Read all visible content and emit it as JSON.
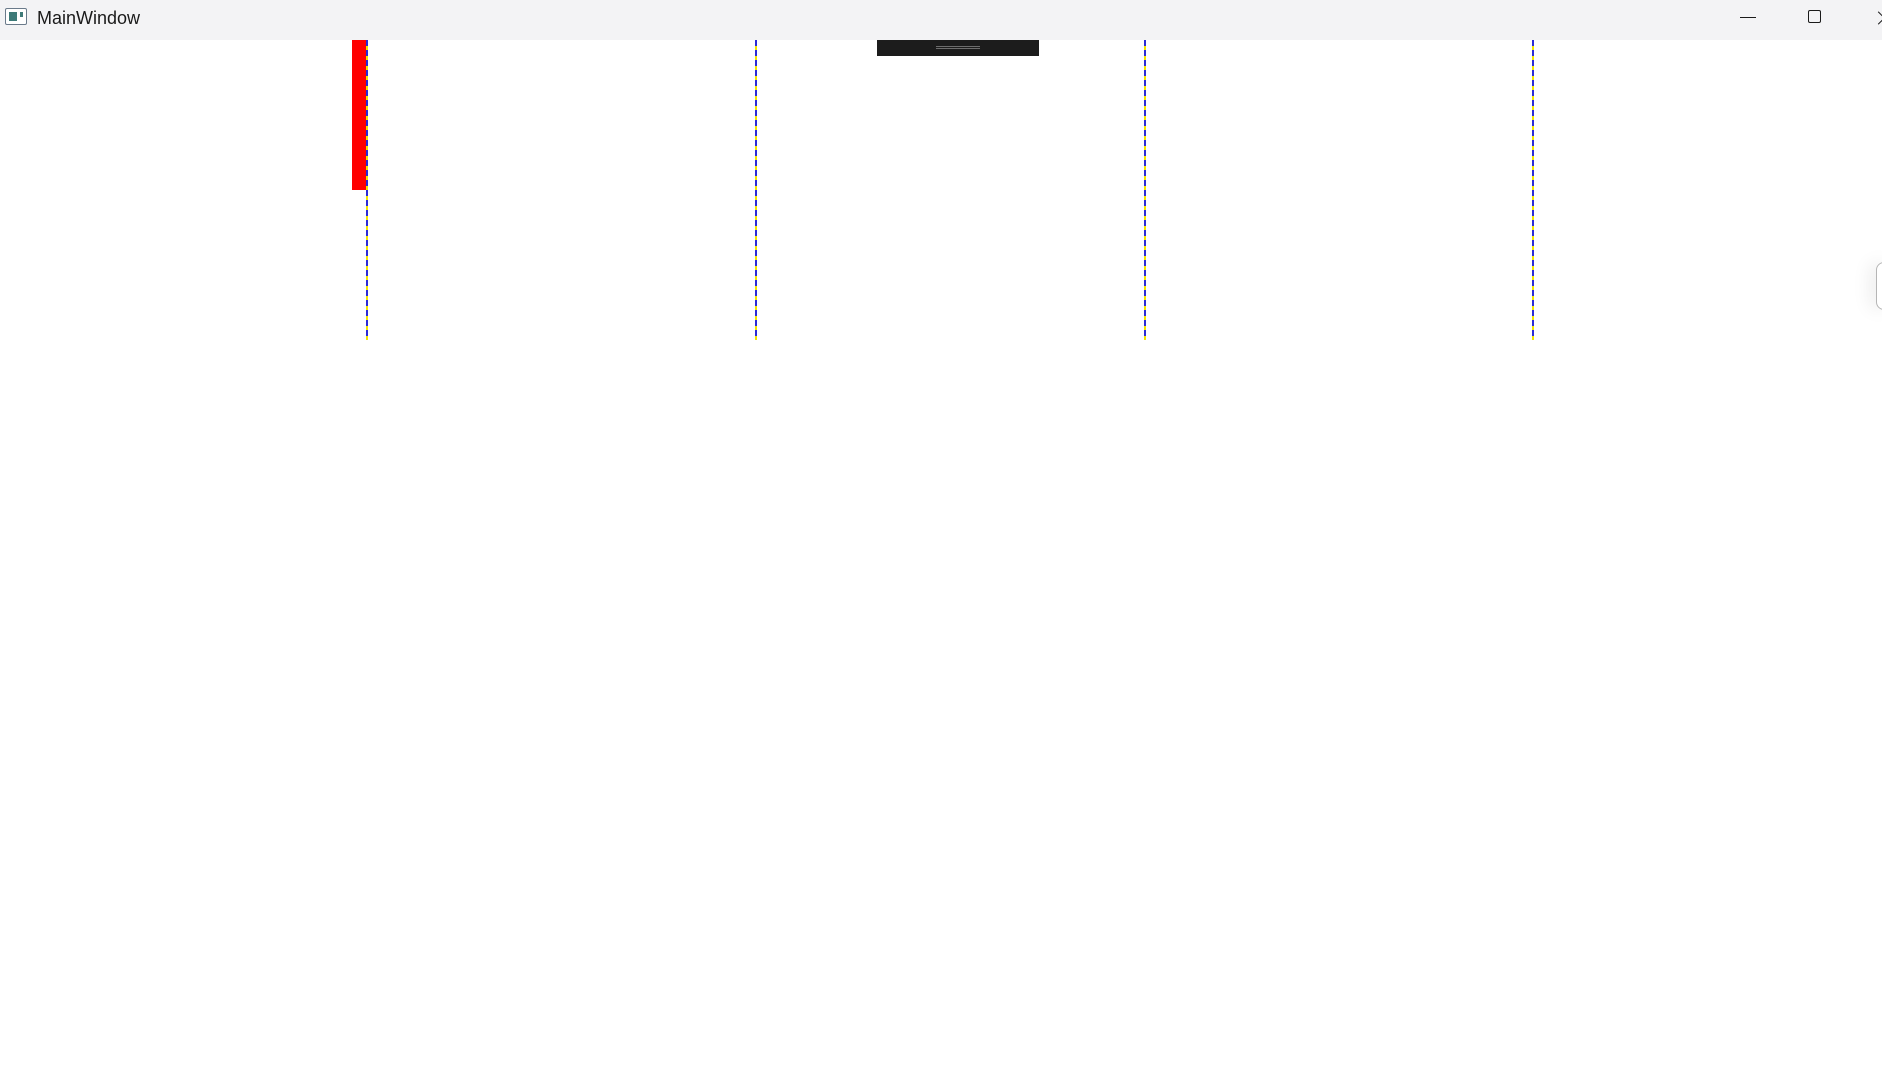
{
  "window": {
    "title": "MainWindow"
  },
  "colors": {
    "titlebar_background": "#f3f3f5",
    "marker_bar": "#ff0000",
    "dash_primary": "#2b2bd6",
    "dash_secondary": "#f2e500",
    "panel_background": "#1c1c1c"
  },
  "icons": {
    "app": "app-window-icon",
    "minimize": "minimize-icon",
    "maximize": "maximize-icon",
    "close": "close-icon",
    "grip": "drag-grip-icon"
  },
  "guide_lines_count": 4
}
